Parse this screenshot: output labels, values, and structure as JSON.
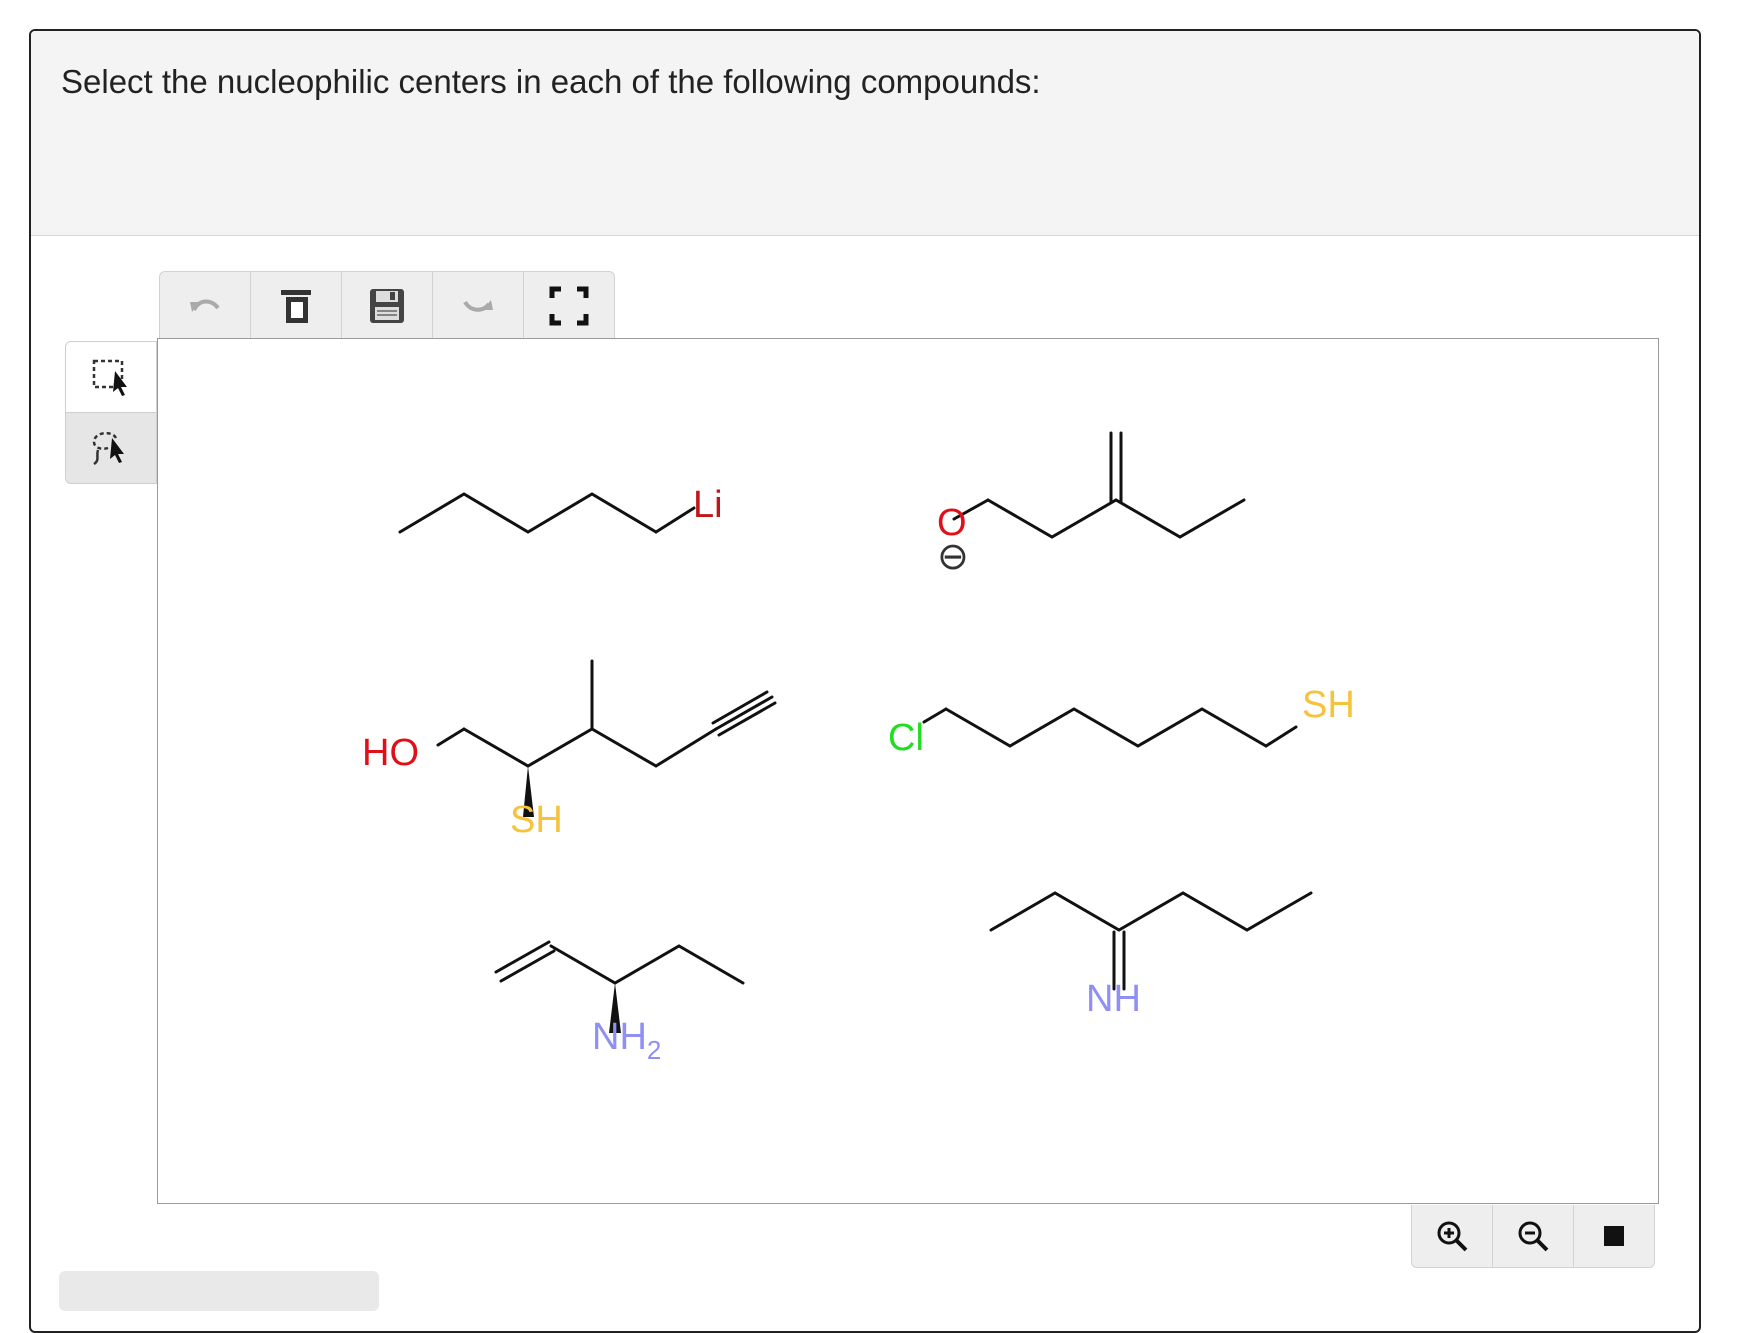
{
  "prompt": {
    "text": "Select the nucleophilic centers in each of the following compounds:"
  },
  "toolbar": {
    "buttons": [
      "undo-icon",
      "clear-icon",
      "save-icon",
      "redo-icon",
      "fullscreen-icon"
    ]
  },
  "side_tools": [
    "rectangle-select-icon",
    "lasso-select-icon"
  ],
  "zoom_bar": [
    "zoom-in-icon",
    "zoom-out-icon",
    "reset-icon"
  ],
  "molecules": {
    "m1": {
      "atom": "Li",
      "color": "#c0161a"
    },
    "m2": {
      "atom": "O",
      "charge": "⊖",
      "color": "#e0101a"
    },
    "m3": {
      "atom1": "HO",
      "atom2": "SH",
      "color_o": "#e0101a",
      "color_s": "#f7c23c"
    },
    "m4": {
      "atom1": "Cl",
      "atom2": "SH",
      "color_cl": "#22dd22",
      "color_s": "#f7c23c"
    },
    "m5": {
      "atom_main": "NH",
      "atom_sub": "2",
      "color": "#8f8ff5"
    },
    "m6": {
      "atom": "NH",
      "color": "#8f8ff5"
    }
  }
}
